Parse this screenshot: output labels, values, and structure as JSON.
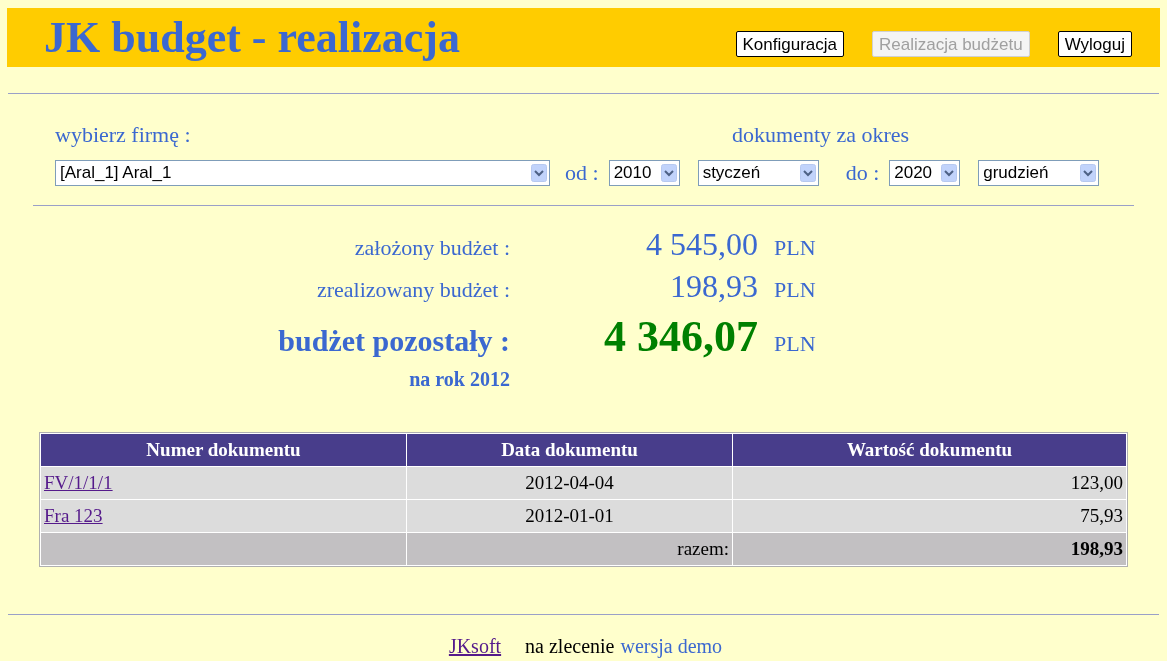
{
  "header": {
    "title": "JK budget - realizacja",
    "buttons": [
      {
        "label": "Konfiguracja",
        "disabled": false
      },
      {
        "label": "Realizacja budżetu",
        "disabled": true
      },
      {
        "label": "Wyloguj",
        "disabled": false
      }
    ]
  },
  "filters": {
    "company_label": "wybierz firmę :",
    "period_label": "dokumenty za okres",
    "company": "[Aral_1] Aral_1",
    "from_label": "od :",
    "from_year": "2010",
    "from_month": "styczeń",
    "to_label": "do :",
    "to_year": "2020",
    "to_month": "grudzień"
  },
  "summary": [
    {
      "kind": "normal",
      "label": "założony budżet :",
      "value": "4 545,00",
      "currency": "PLN"
    },
    {
      "kind": "normal",
      "label": "zrealizowany budżet :",
      "value": "198,93",
      "currency": "PLN"
    },
    {
      "kind": "highlight",
      "label": "budżet pozostały :",
      "value": "4 346,07",
      "currency": "PLN"
    }
  ],
  "year_note": "na rok 2012",
  "table": {
    "columns": [
      "Numer dokumentu",
      "Data dokumentu",
      "Wartość dokumentu"
    ],
    "rows": [
      {
        "number": "FV/1/1/1",
        "date": "2012-04-04",
        "value": "123,00"
      },
      {
        "number": "Fra 123",
        "date": "2012-01-01",
        "value": "75,93"
      }
    ],
    "total_label": "razem:",
    "total": "198,93"
  },
  "footer": {
    "link": "JKsoft",
    "text": "na zlecenie",
    "demo": "wersja demo"
  }
}
